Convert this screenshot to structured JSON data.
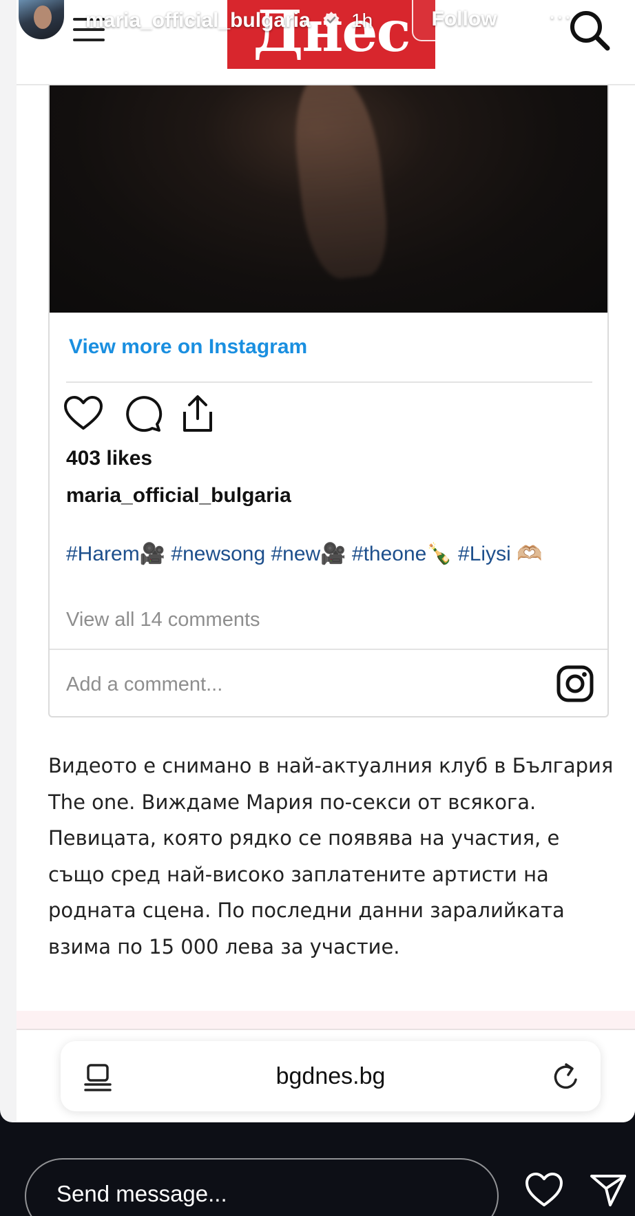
{
  "story": {
    "username": "maria_official_bulgaria",
    "time": "1h",
    "follow_label": "Follow",
    "more_label": "···",
    "message_placeholder": "Send message..."
  },
  "site": {
    "logo_text": "Днес"
  },
  "embed": {
    "view_more": "View more on Instagram",
    "likes": "403 likes",
    "username": "maria_official_bulgaria",
    "hashtags": "#Harem🎥 #newsong #new🎥 #theone🍾 #Liysi 🫶🏼",
    "view_comments": "View all 14 comments",
    "comment_placeholder": "Add a comment..."
  },
  "article": {
    "text": "Видеото е снимано в най-актуалния клуб в България\nThe one. Виждаме Мария по-секси от всякога.\nПевицата, която рядко се появява на участия, е\nсъщо сред най-високо заплатените артисти на\nродната сцена. По последни данни заралийката\nвзима по 15 000 лева за участие."
  },
  "browser": {
    "url": "bgdnes.bg"
  },
  "icons": {
    "menu": "menu-icon",
    "search": "search-icon",
    "verified": "verified-icon",
    "close": "close-icon",
    "like": "heart-icon",
    "comment": "comment-icon",
    "share": "share-icon",
    "bookmark": "bookmark-icon",
    "instagram": "instagram-icon",
    "reader": "reader-icon",
    "reload": "reload-icon",
    "send": "send-icon"
  },
  "colors": {
    "logo_red": "#d8262d",
    "link_blue": "#1a8fe0",
    "hashtag_blue": "#1d4f8c",
    "story_bg": "#0d0f16"
  }
}
